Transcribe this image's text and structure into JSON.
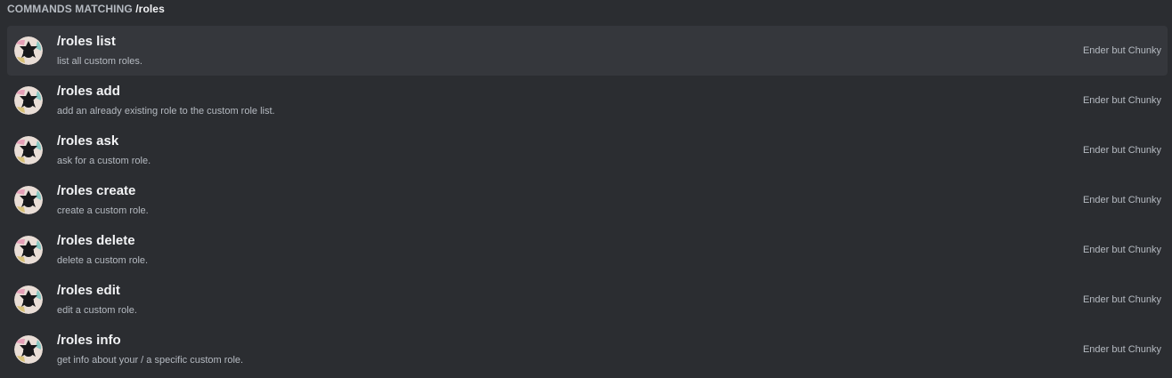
{
  "header": {
    "prefix": "COMMANDS MATCHING ",
    "query": "/roles"
  },
  "commands": [
    {
      "name": "/roles list",
      "description": "list all custom roles.",
      "source": "Ender but Chunky",
      "selected": true
    },
    {
      "name": "/roles add",
      "description": "add an already existing role to the custom role list.",
      "source": "Ender but Chunky",
      "selected": false
    },
    {
      "name": "/roles ask",
      "description": "ask for a custom role.",
      "source": "Ender but Chunky",
      "selected": false
    },
    {
      "name": "/roles create",
      "description": "create a custom role.",
      "source": "Ender but Chunky",
      "selected": false
    },
    {
      "name": "/roles delete",
      "description": "delete a custom role.",
      "source": "Ender but Chunky",
      "selected": false
    },
    {
      "name": "/roles edit",
      "description": "edit a custom role.",
      "source": "Ender but Chunky",
      "selected": false
    },
    {
      "name": "/roles info",
      "description": "get info about your / a specific custom role.",
      "source": "Ender but Chunky",
      "selected": false
    }
  ],
  "colors": {
    "background": "#2b2d31",
    "selected_row": "#35373c",
    "title_text": "#f2f3f5",
    "muted_text": "#b5bac1"
  },
  "icons": {
    "bot_avatar": "bot-avatar-icon"
  }
}
